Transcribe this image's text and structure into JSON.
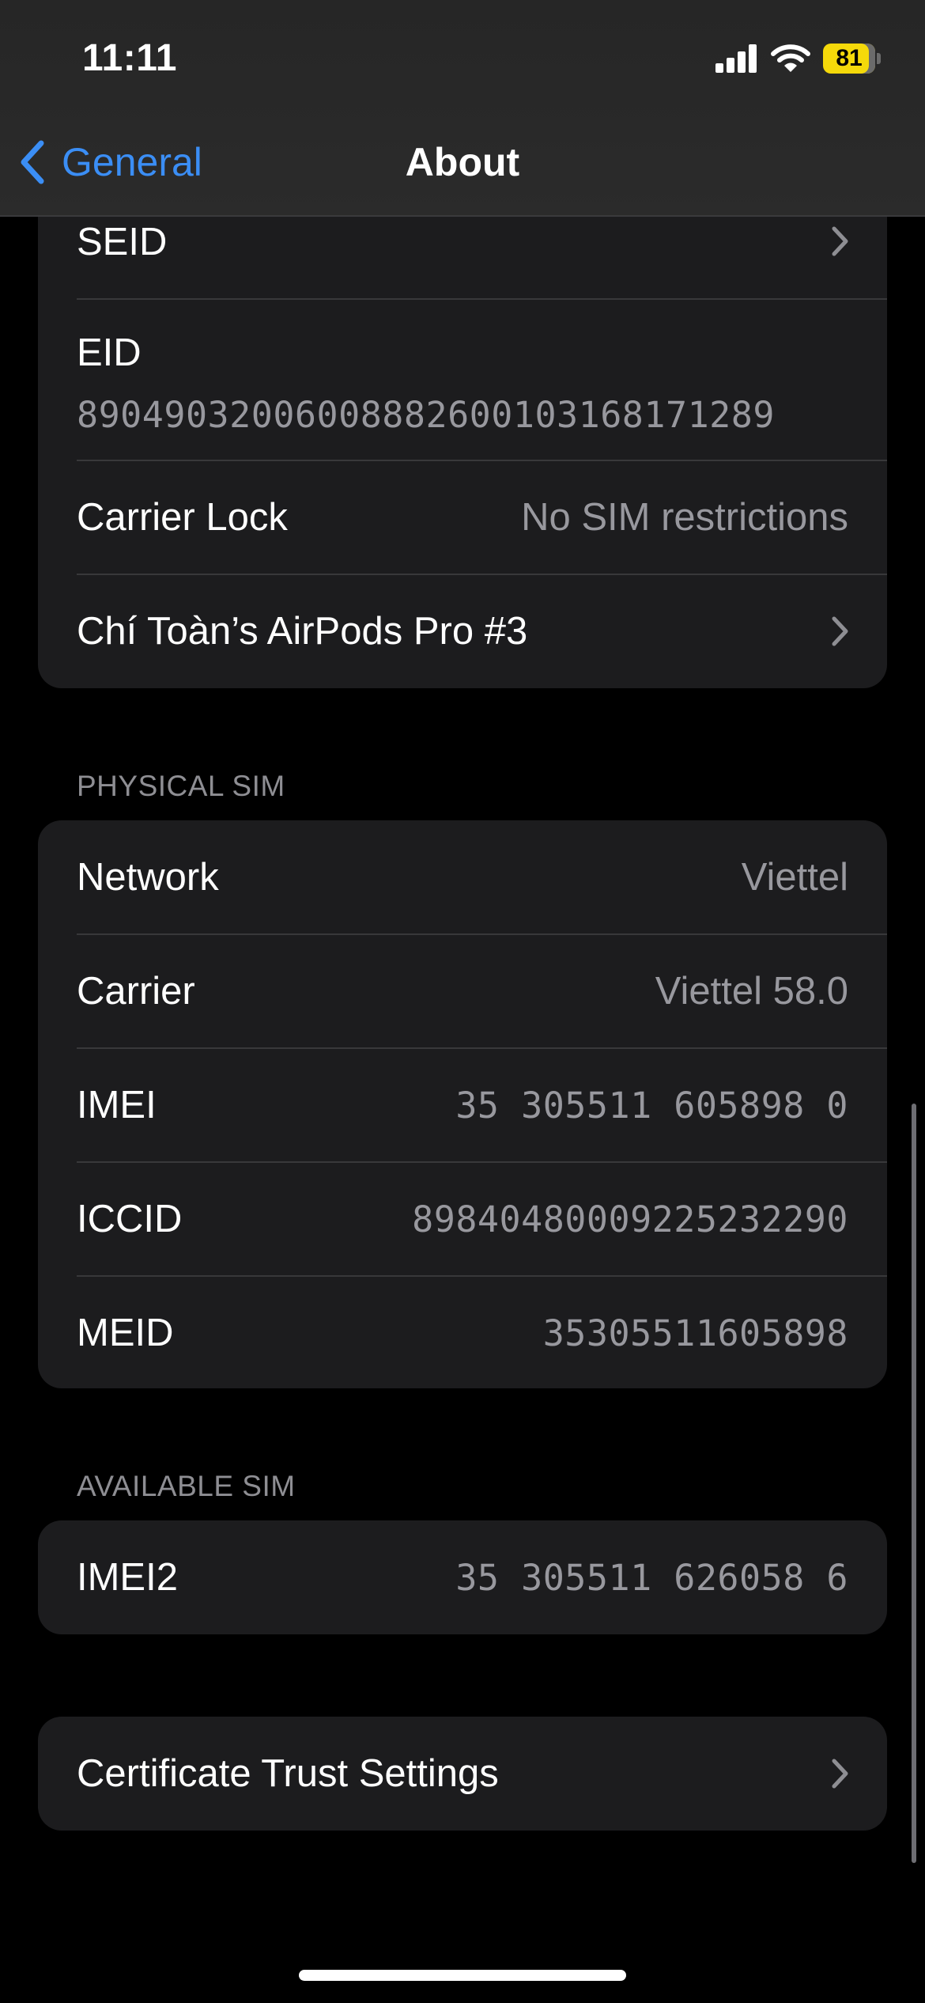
{
  "status_bar": {
    "time": "11:11",
    "battery_percent": "81",
    "icons": [
      "signal-icon",
      "wifi-icon",
      "battery-icon"
    ]
  },
  "nav": {
    "back_label": "General",
    "title": "About"
  },
  "top_group": {
    "seid_label": "SEID",
    "eid_label": "EID",
    "eid_value": "89049032006008882600103168171289",
    "carrier_lock_label": "Carrier Lock",
    "carrier_lock_value": "No SIM restrictions",
    "airpods_label": "Chí Toàn’s AirPods Pro #3"
  },
  "physical_sim": {
    "header": "PHYSICAL SIM",
    "rows": [
      {
        "label": "Network",
        "value": "Viettel"
      },
      {
        "label": "Carrier",
        "value": "Viettel 58.0"
      },
      {
        "label": "IMEI",
        "value": "35 305511 605898 0"
      },
      {
        "label": "ICCID",
        "value": "89840480009225232290"
      },
      {
        "label": "MEID",
        "value": "35305511605898"
      }
    ]
  },
  "available_sim": {
    "header": "AVAILABLE SIM",
    "imei2_label": "IMEI2",
    "imei2_value": "35 305511 626058 6"
  },
  "certificate": {
    "label": "Certificate Trust Settings"
  },
  "colors": {
    "background": "#000000",
    "cell": "#1c1c1e",
    "accent": "#3b8ef5",
    "secondary_text": "#98989e",
    "battery": "#f5d90a"
  }
}
